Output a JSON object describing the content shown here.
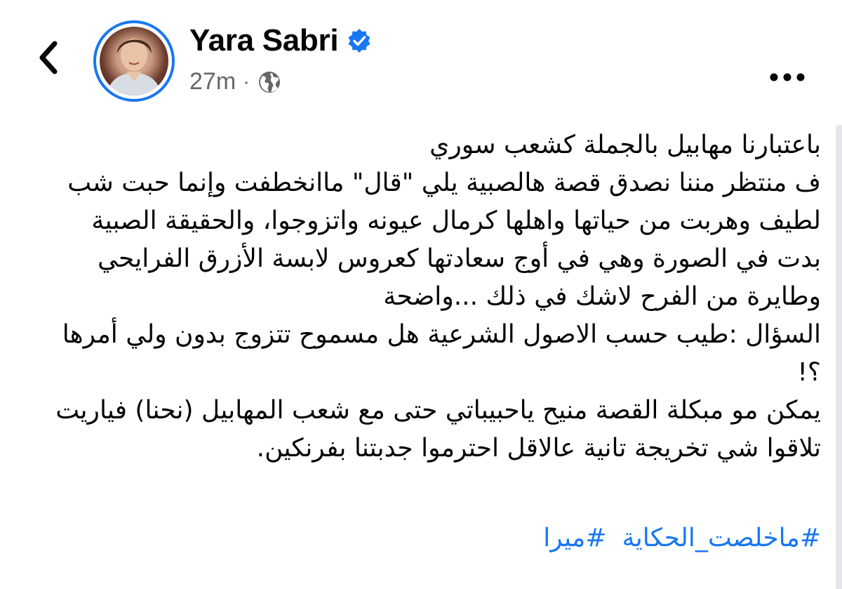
{
  "header": {
    "back_icon": "chevron-left-icon",
    "author_name": "Yara Sabri",
    "verified_icon": "verified-badge-icon",
    "timestamp": "27m",
    "separator": "·",
    "audience_icon": "globe-icon",
    "more_icon": "more-horizontal-icon"
  },
  "post": {
    "paragraphs": [
      "باعتبارنا مهابيل بالجملة كشعب سوري",
      "ف منتظر مننا نصدق قصة هالصبية يلي \"قال\" ماانخطفت وإنما حبت شب لطيف وهربت من حياتها واهلها كرمال عيونه واتزوجوا، والحقيقة الصبية بدت في الصورة وهي في أوج سعادتها كعروس لابسة الأزرق الفرايحي وطايرة من الفرح لاشك في ذلك ...واضحة",
      "السؤال :طيب حسب الاصول الشرعية هل مسموح تتزوج بدون ولي أمرها ؟!",
      "يمكن مو مبكلة القصة منيح ياحبيباتي حتى مع شعب المهابيل (نحنا) فياريت تلاقوا شي تخريجة تانية عالاقل احترموا جدبتنا بفرنكين."
    ],
    "hashtags": [
      "#ماخلصت_الحكاية",
      "#ميرا"
    ]
  },
  "colors": {
    "accent": "#1877f2",
    "text": "#050505",
    "meta": "#65676b"
  }
}
